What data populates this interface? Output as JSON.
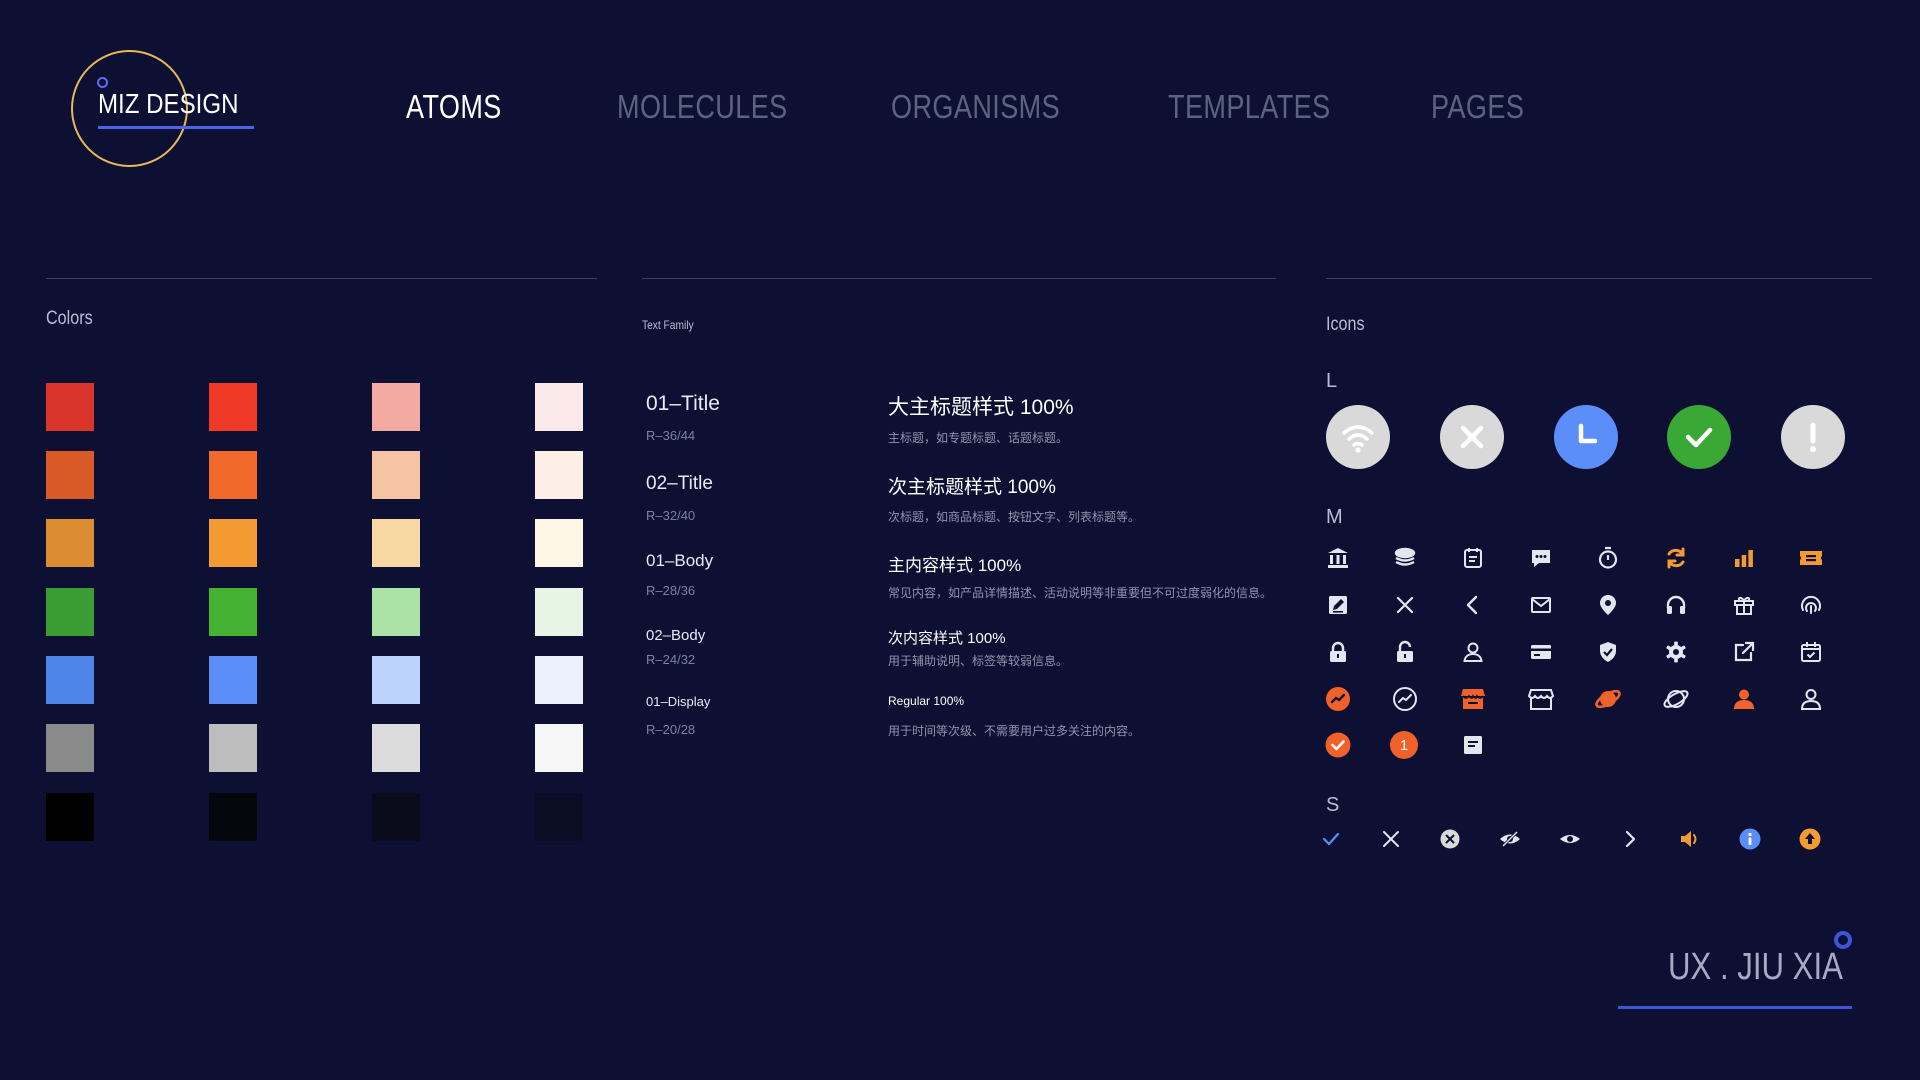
{
  "brand": {
    "logo_text": "MIZ DESIGN"
  },
  "nav": {
    "items": [
      {
        "label": "ATOMS",
        "active": true
      },
      {
        "label": "MOLECULES",
        "active": false
      },
      {
        "label": "ORGANISMS",
        "active": false
      },
      {
        "label": "TEMPLATES",
        "active": false
      },
      {
        "label": "PAGES",
        "active": false
      }
    ]
  },
  "colors": {
    "title": "Colors",
    "rows": [
      [
        "#d9352a",
        "#ee3a26",
        "#f3aaa2",
        "#fce9e9"
      ],
      [
        "#d95a26",
        "#f26a2b",
        "#f7c4a3",
        "#fdeee6"
      ],
      [
        "#dc8d32",
        "#f49a32",
        "#f8d8a3",
        "#fdf5e6"
      ],
      [
        "#3a9c33",
        "#46b233",
        "#aae3a5",
        "#e7f5e5"
      ],
      [
        "#4f84e8",
        "#5b8ef8",
        "#bcd4fb",
        "#ebf2fe"
      ],
      [
        "#8a8a8a",
        "#bdbdbd",
        "#dcdcdc",
        "#f6f6f6"
      ],
      [
        "#000000",
        "#05070d",
        "#0a0c1c",
        "#0b0d24"
      ]
    ]
  },
  "text_family": {
    "title": "Text Family",
    "styles": [
      {
        "name": "01–Title",
        "spec": "R–36/44",
        "sample": "大主标题样式 100%",
        "desc": "主标题，如专题标题、话题标题。"
      },
      {
        "name": "02–Title",
        "spec": "R–32/40",
        "sample": "次主标题样式 100%",
        "desc": "次标题，如商品标题、按钮文字、列表标题等。"
      },
      {
        "name": "01–Body",
        "spec": "R–28/36",
        "sample": "主内容样式 100%",
        "desc": "常见内容，如产品详情描述、活动说明等非重要但不可过度弱化的信息。"
      },
      {
        "name": "02–Body",
        "spec": "R–24/32",
        "sample": "次内容样式 100%",
        "desc": "用于辅助说明、标签等较弱信息。"
      },
      {
        "name": "01–Display",
        "spec": "R–20/28",
        "sample": "Regular 100%",
        "desc": "用于时间等次级、不需要用户过多关注的内容。"
      }
    ]
  },
  "icons": {
    "title": "Icons",
    "size_labels": {
      "large": "L",
      "medium": "M",
      "small": "S"
    },
    "large": [
      {
        "name": "wifi-icon",
        "bg": "#d9d9d9"
      },
      {
        "name": "close-icon",
        "bg": "#d9d9d9"
      },
      {
        "name": "clock-icon",
        "bg": "#5b8ef8"
      },
      {
        "name": "check-icon",
        "bg": "#3aa835"
      },
      {
        "name": "alert-icon",
        "bg": "#d9d9d9"
      }
    ],
    "medium": [
      "bank-icon",
      "coin-stack-icon",
      "calendar-note-icon",
      "message-icon",
      "stopwatch-icon",
      "refresh-icon",
      "bar-chart-icon",
      "ticket-icon",
      "edit-icon",
      "close-icon",
      "chevron-left-icon",
      "mail-icon",
      "location-icon",
      "headset-icon",
      "gift-icon",
      "fingerprint-icon",
      "lock-closed-icon",
      "lock-open-icon",
      "user-outline-icon",
      "credit-card-icon",
      "shield-check-icon",
      "settings-icon",
      "external-link-icon",
      "calendar-check-icon",
      "trend-filled-icon",
      "trend-outline-icon",
      "store-filled-icon",
      "store-outline-icon",
      "planet-filled-icon",
      "planet-outline-icon",
      "user-filled-icon",
      "user-thin-icon",
      "check-badge-icon",
      "number-badge-icon",
      "document-icon"
    ],
    "badge_number": "1",
    "small": [
      "check-small-icon",
      "close-small-icon",
      "close-circle-icon",
      "eye-off-icon",
      "eye-icon",
      "chevron-right-icon",
      "volume-icon",
      "info-icon",
      "upload-icon"
    ],
    "accent_orange": "#f0622a",
    "accent_amber": "#f49a32",
    "accent_blue": "#5b8ef8",
    "neutral": "#e4e6ef"
  },
  "footer": {
    "signature": "UX . JIU XIA"
  }
}
